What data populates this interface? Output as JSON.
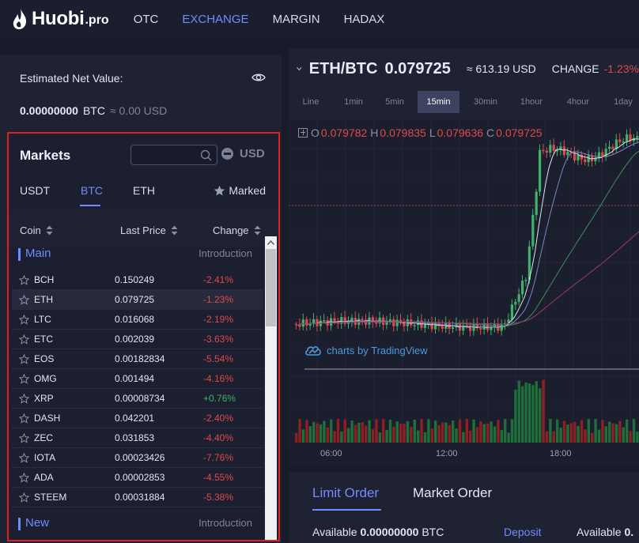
{
  "nav": {
    "logo": "Huobi",
    "logo_suffix": ".pro",
    "items": [
      "OTC",
      "EXCHANGE",
      "MARGIN",
      "HADAX"
    ],
    "active": "EXCHANGE"
  },
  "balance": {
    "label": "Estimated Net Value:",
    "amount": "0.00000000",
    "currency": "BTC",
    "usd": "≈ 0.00 USD"
  },
  "markets": {
    "title": "Markets",
    "search_placeholder": "",
    "usd_label": "USD",
    "tabs": [
      "USDT",
      "BTC",
      "ETH"
    ],
    "active_tab": "BTC",
    "marked_label": "Marked",
    "columns": [
      "Coin",
      "Last Price",
      "Change"
    ],
    "main_section": "Main",
    "new_section": "New",
    "intro_label": "Introduction",
    "rows": [
      {
        "coin": "BCH",
        "price": "0.150249",
        "change": "-2.41%",
        "dir": "neg"
      },
      {
        "coin": "ETH",
        "price": "0.079725",
        "change": "-1.23%",
        "dir": "neg"
      },
      {
        "coin": "LTC",
        "price": "0.016068",
        "change": "-2.19%",
        "dir": "neg"
      },
      {
        "coin": "ETC",
        "price": "0.002039",
        "change": "-3.63%",
        "dir": "neg"
      },
      {
        "coin": "EOS",
        "price": "0.00182834",
        "change": "-5.54%",
        "dir": "neg"
      },
      {
        "coin": "OMG",
        "price": "0.001494",
        "change": "-4.16%",
        "dir": "neg"
      },
      {
        "coin": "XRP",
        "price": "0.00008734",
        "change": "+0.76%",
        "dir": "pos"
      },
      {
        "coin": "DASH",
        "price": "0.042201",
        "change": "-2.40%",
        "dir": "neg"
      },
      {
        "coin": "ZEC",
        "price": "0.031853",
        "change": "-4.40%",
        "dir": "neg"
      },
      {
        "coin": "IOTA",
        "price": "0.00023426",
        "change": "-7.76%",
        "dir": "neg"
      },
      {
        "coin": "ADA",
        "price": "0.00002853",
        "change": "-4.55%",
        "dir": "neg"
      },
      {
        "coin": "STEEM",
        "price": "0.00031884",
        "change": "-5.38%",
        "dir": "neg"
      }
    ],
    "highlighted_coin": "ETH"
  },
  "chart": {
    "pair": "ETH/BTC",
    "price": "0.079725",
    "usd_equiv": "≈ 613.19 USD",
    "change_label": "CHANGE",
    "change_value": "-1.23%",
    "intervals": [
      "Line",
      "1min",
      "5min",
      "15min",
      "30min",
      "1hour",
      "4hour",
      "1day"
    ],
    "active_interval": "15min",
    "ohlc": {
      "O": "0.079782",
      "H": "0.079835",
      "L": "0.079636",
      "C": "0.079725"
    },
    "watermark": "charts by TradingView",
    "time_labels": [
      "06:00",
      "12:00",
      "18:00"
    ],
    "colors": {
      "up": "#3fb16a",
      "down": "#e0494b"
    }
  },
  "orders": {
    "tabs": [
      "Limit Order",
      "Market Order"
    ],
    "active_tab": "Limit Order",
    "available_label": "Available",
    "available_amount": "0.00000000",
    "available_currency": "BTC",
    "deposit_label": "Deposit",
    "available2_label": "Available",
    "available2_amount": "0."
  }
}
